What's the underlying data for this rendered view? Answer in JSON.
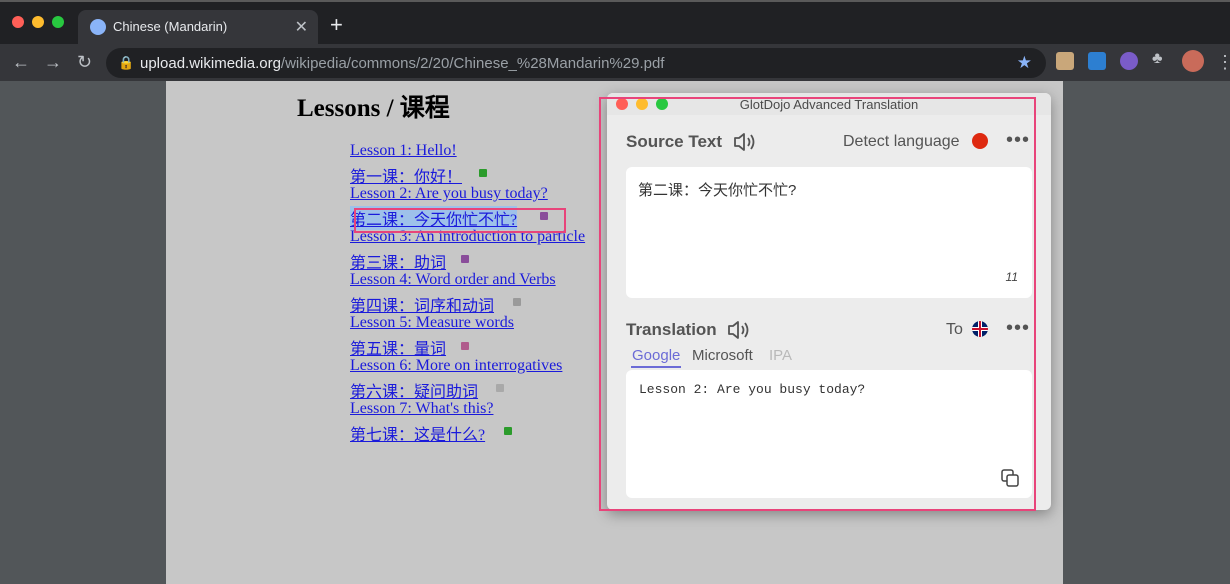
{
  "browser": {
    "tab_title": "Chinese (Mandarin)",
    "tab_close": "✕",
    "new_tab": "+",
    "url_host": "upload.wikimedia.org",
    "url_path": "/wikipedia/commons/2/20/Chinese_%28Mandarin%29.pdf",
    "back": "←",
    "forward": "→",
    "reload": "↻",
    "bookmark_star": "★",
    "menu": "⋮"
  },
  "document": {
    "heading": "Lessons / 课程",
    "lessons": [
      "Lesson 1: Hello!",
      "第一课：你好！",
      "Lesson 2: Are you busy today?",
      "第二课：今天你忙不忙?",
      "Lesson 3: An introduction to particle",
      "第三课：助词",
      "Lesson 4: Word order and Verbs",
      "第四课：词序和动词",
      "Lesson 5: Measure words",
      "第五课：量词",
      "Lesson 6: More on interrogatives",
      "第六课：疑问助词",
      "Lesson 7: What's this?",
      "第七课：这是什么?"
    ]
  },
  "glotdojo": {
    "window_title": "GlotDojo Advanced Translation",
    "source_label": "Source Text",
    "detect_language": "Detect language",
    "source_text": "第二课：今天你忙不忙?",
    "char_count": "11",
    "translation_label": "Translation",
    "to_label": "To",
    "more": "•••",
    "engines": [
      "Google",
      "Microsoft",
      "IPA"
    ],
    "active_engine": "Google",
    "translation_text": "Lesson 2: Are you busy today?"
  },
  "colors": {
    "link": "#1a1adb",
    "highlight": "#e8447a",
    "google_active": "#6b6bd6",
    "ipa_disabled": "#b9b9b9"
  }
}
